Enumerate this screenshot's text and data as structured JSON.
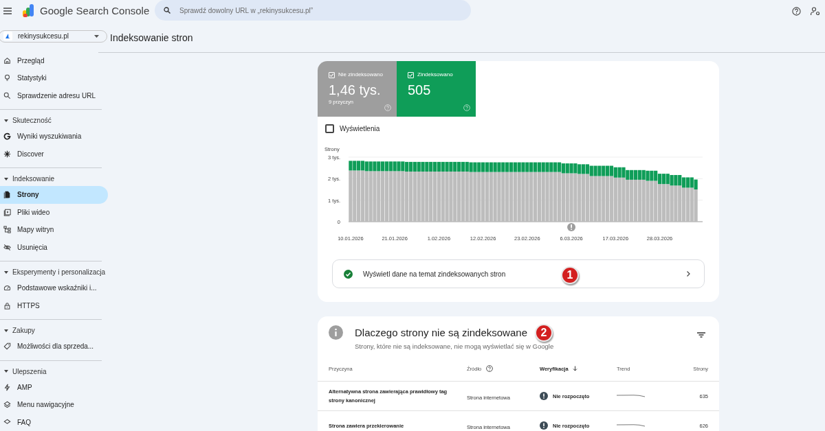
{
  "header": {
    "product": "Google Search Console",
    "search": {
      "placeholder": "Sprawdź dowolny URL w „rekinysukcesu.pl”"
    }
  },
  "property": {
    "name": "rekinysukcesu.pl"
  },
  "sidebar": {
    "groups": [
      {
        "items": [
          {
            "label": "Przegląd",
            "selected": false
          },
          {
            "label": "Statystyki",
            "selected": false
          },
          {
            "label": "Sprawdzenie adresu URL",
            "selected": false
          }
        ]
      },
      {
        "title": "Skuteczność",
        "expanded": true,
        "items": [
          {
            "label": "Wyniki wyszukiwania",
            "selected": false
          },
          {
            "label": "Discover",
            "selected": false
          }
        ]
      },
      {
        "title": "Indeksowanie",
        "expanded": true,
        "items": [
          {
            "label": "Strony",
            "selected": true
          },
          {
            "label": "Pliki wideo",
            "selected": false
          },
          {
            "label": "Mapy witryn",
            "selected": false
          },
          {
            "label": "Usunięcia",
            "selected": false
          }
        ]
      },
      {
        "title": "Eksperymenty i personalizacja",
        "expanded": true,
        "items": [
          {
            "label": "Podstawowe wskaźniki i...",
            "selected": false
          },
          {
            "label": "HTTPS",
            "selected": false
          }
        ]
      },
      {
        "title": "Zakupy",
        "expanded": true,
        "items": [
          {
            "label": "Możliwości dla sprzeda...",
            "selected": false
          }
        ]
      },
      {
        "title": "Ulepszenia",
        "expanded": true,
        "items": [
          {
            "label": "AMP",
            "selected": false
          },
          {
            "label": "Menu nawigacyjne",
            "selected": false
          },
          {
            "label": "FAQ",
            "selected": false
          }
        ]
      }
    ]
  },
  "page_title": "Indeksowanie stron",
  "summary": {
    "tiles": [
      {
        "label": "Nie zindeksowano",
        "value": "1,46 tys.",
        "note": "9 przyczyn",
        "checked": true,
        "color": "#9e9e9e"
      },
      {
        "label": "Zindeksowano",
        "value": "505",
        "checked": true,
        "color": "#0f9d58"
      }
    ],
    "impressions": {
      "label": "Wyświetlenia",
      "checked": false
    },
    "chart_data": {
      "type": "bar",
      "stacked": true,
      "ylabel": "Strony",
      "ylim": [
        0,
        3
      ],
      "yticks": [
        {
          "value": 0,
          "label": "0"
        },
        {
          "value": 1,
          "label": "1 tys."
        },
        {
          "value": 2,
          "label": "2 tys."
        },
        {
          "value": 3,
          "label": "3 tys."
        }
      ],
      "categories": [
        "10.01.2026",
        null,
        null,
        null,
        null,
        null,
        null,
        null,
        null,
        null,
        null,
        "21.01.2026",
        null,
        null,
        null,
        null,
        null,
        null,
        null,
        null,
        null,
        null,
        "1.02.2026",
        null,
        null,
        null,
        null,
        null,
        null,
        null,
        null,
        null,
        null,
        "12.02.2026",
        null,
        null,
        null,
        null,
        null,
        null,
        null,
        null,
        null,
        null,
        "23.02.2026",
        null,
        null,
        null,
        null,
        null,
        null,
        null,
        null,
        null,
        null,
        "6.03.2026",
        null,
        null,
        null,
        null,
        null,
        null,
        null,
        null,
        null,
        null,
        "17.03.2026",
        null,
        null,
        null,
        null,
        null,
        null,
        null,
        null,
        null,
        null,
        "28.03.2026",
        null,
        null,
        null,
        null,
        null,
        null,
        null,
        null,
        null
      ],
      "series": [
        {
          "color": "#bdbdbd",
          "values": [
            2.38,
            2.38,
            2.38,
            2.38,
            2.35,
            2.35,
            2.35,
            2.35,
            2.35,
            2.35,
            2.35,
            2.35,
            2.35,
            2.35,
            2.33,
            2.33,
            2.33,
            2.33,
            2.33,
            2.33,
            2.33,
            2.33,
            2.33,
            2.33,
            2.33,
            2.33,
            2.33,
            2.33,
            2.33,
            2.33,
            2.31,
            2.31,
            2.31,
            2.31,
            2.31,
            2.31,
            2.31,
            2.31,
            2.31,
            2.31,
            2.31,
            2.31,
            2.31,
            2.31,
            2.31,
            2.31,
            2.31,
            2.31,
            2.31,
            2.31,
            2.31,
            2.31,
            2.31,
            2.25,
            2.25,
            2.25,
            2.25,
            2.22,
            2.22,
            2.22,
            2.12,
            2.12,
            2.12,
            2.12,
            2.12,
            2.12,
            2.05,
            2.05,
            2.05,
            1.95,
            1.95,
            1.95,
            1.95,
            1.95,
            1.9,
            1.9,
            1.9,
            1.75,
            1.75,
            1.75,
            1.68,
            1.68,
            1.68,
            1.58,
            1.58,
            1.58,
            1.5
          ]
        },
        {
          "color": "#0f9d58",
          "values": [
            0.45,
            0.45,
            0.45,
            0.45,
            0.45,
            0.45,
            0.45,
            0.45,
            0.45,
            0.45,
            0.45,
            0.45,
            0.45,
            0.45,
            0.45,
            0.45,
            0.45,
            0.45,
            0.45,
            0.45,
            0.45,
            0.45,
            0.45,
            0.45,
            0.45,
            0.45,
            0.45,
            0.45,
            0.45,
            0.45,
            0.45,
            0.45,
            0.45,
            0.45,
            0.45,
            0.45,
            0.45,
            0.45,
            0.45,
            0.45,
            0.45,
            0.45,
            0.45,
            0.45,
            0.45,
            0.45,
            0.45,
            0.45,
            0.45,
            0.45,
            0.45,
            0.45,
            0.45,
            0.46,
            0.46,
            0.46,
            0.46,
            0.45,
            0.45,
            0.45,
            0.48,
            0.48,
            0.48,
            0.48,
            0.48,
            0.48,
            0.48,
            0.48,
            0.48,
            0.45,
            0.45,
            0.45,
            0.45,
            0.45,
            0.47,
            0.47,
            0.47,
            0.48,
            0.48,
            0.48,
            0.49,
            0.49,
            0.49,
            0.48,
            0.48,
            0.48,
            0.46
          ]
        }
      ]
    },
    "link": {
      "label": "Wyświetl dane na temat zindeksowanych stron",
      "callout": "1"
    }
  },
  "reasons": {
    "title": "Dlaczego strony nie są zindeksowane",
    "callout": "2",
    "subtitle": "Strony, które nie są indeksowane, nie mogą wyświetlać się w Google",
    "table": {
      "columns": [
        {
          "label": "Przyczyna",
          "sorted": false
        },
        {
          "label": "Źródło",
          "sorted": false
        },
        {
          "label": "Weryfikacja",
          "sorted": true
        },
        {
          "label": "Trend",
          "sorted": false
        },
        {
          "label": "Strony",
          "sorted": false
        }
      ],
      "rows": [
        {
          "reason": "Alternatywna strona zawierająca prawidłowy tag strony kanonicznej",
          "source": "Strona internetowa",
          "validation": "Nie rozpoczęto",
          "pages": "635"
        },
        {
          "reason": "Strona zawiera przekierowanie",
          "source": "Strona internetowa",
          "validation": "Nie rozpoczęto",
          "pages": "626"
        }
      ]
    }
  }
}
